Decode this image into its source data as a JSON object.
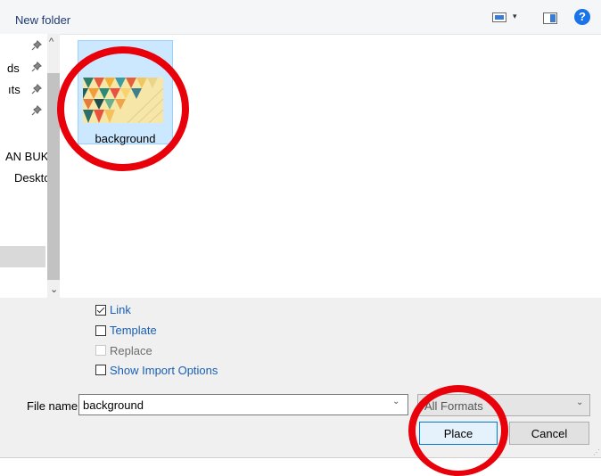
{
  "toolbar": {
    "new_folder_label": "New folder",
    "views_icon": "views-icon",
    "views_dropdown_glyph": "▾",
    "preview_icon": "preview-pane-icon",
    "help_glyph": "?"
  },
  "nav": {
    "items": [
      {
        "label": ""
      },
      {
        "label": "ds"
      },
      {
        "label": "ıts"
      },
      {
        "label": ""
      },
      {
        "label": "AN BUK"
      },
      {
        "label": "Desktc"
      }
    ],
    "scroll_up_glyph": "^",
    "scroll_down_glyph": "⌄"
  },
  "files": [
    {
      "name": "background",
      "selected": true
    }
  ],
  "options": {
    "link_label": "Link",
    "link_checked": true,
    "template_label": "Template",
    "template_checked": false,
    "replace_label": "Replace",
    "replace_enabled": false,
    "show_import_options_label": "Show Import Options",
    "show_import_options_checked": false
  },
  "file_name": {
    "label": "File name:",
    "value": "background",
    "dropdown_glyph": "⌄"
  },
  "format": {
    "selected": "All Formats",
    "dropdown_glyph": "⌄"
  },
  "buttons": {
    "place_label": "Place",
    "cancel_label": "Cancel"
  },
  "annotation_color": "#e8000a",
  "accent_color": "#0078d7"
}
